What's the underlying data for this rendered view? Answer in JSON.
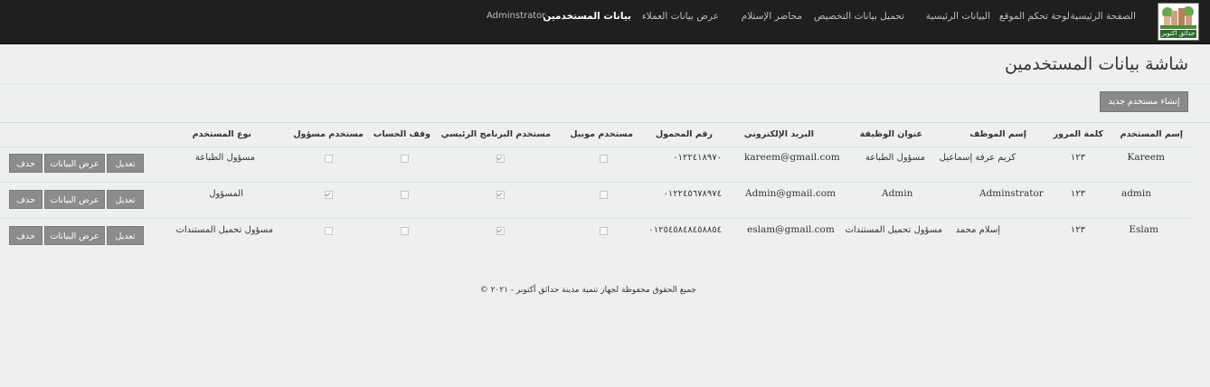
{
  "nav": {
    "logo_text": "حدائق أكتوبر",
    "items": [
      {
        "label": "الصفحة الرئيسية",
        "active": false
      },
      {
        "label": "لوحة تحكم الموقع",
        "active": false
      },
      {
        "label": "البيانات الرئيسية",
        "active": false
      },
      {
        "label": "تحميل بيانات التخصيص",
        "active": false
      },
      {
        "label": "محاضر الإستلام",
        "active": false
      },
      {
        "label": "عرض بيانات العملاء",
        "active": false
      },
      {
        "label": "بيانات المستخدمين",
        "active": true
      },
      {
        "label": "Adminstrator",
        "active": false
      }
    ]
  },
  "page": {
    "title": "شاشة بيانات المستخدمين",
    "create_button": "إنشاء مستخدم جديد"
  },
  "table": {
    "columns": [
      "إسم المستخدم",
      "كلمة المرور",
      "إسم الموظف",
      "عنوان الوظيفة",
      "البريد الإلكتروني",
      "رقم المحمول",
      "مستخدم موبيل",
      "مستخدم البرنامج الرئيسي",
      "وقف الحساب",
      "مستخدم مسؤول",
      "نوع المستخدم"
    ],
    "rows": [
      {
        "username": "Kareem",
        "password": "١٢٣",
        "employee": "كريم عرفة إسماعيل",
        "job": "مسؤول الطباعة",
        "email": "kareem@gmail.com",
        "mobile": "٠١٢٢٤١٨٩٧٠",
        "mobile_user": false,
        "main_user": true,
        "suspended": false,
        "admin_user": false,
        "type": "مسؤول الطباعة"
      },
      {
        "username": "admin",
        "password": "١٢٣",
        "employee": "Adminstrator",
        "job": "Admin",
        "email": "Admin@gmail.com",
        "mobile": "٠١٢٢٤٥٦٧٨٩٧٤",
        "mobile_user": false,
        "main_user": true,
        "suspended": false,
        "admin_user": true,
        "type": "المسؤول"
      },
      {
        "username": "Eslam",
        "password": "١٢٣",
        "employee": "إسلام محمد",
        "job": "مسؤول تحميل المستندات",
        "email": "eslam@gmail.com",
        "mobile": "٠١٢٥٤٥٨٤٨٤٥٨٨٥٤",
        "mobile_user": false,
        "main_user": true,
        "suspended": false,
        "admin_user": false,
        "type": "مسؤول تحميل المستندات"
      }
    ],
    "actions": {
      "edit": "تعديل",
      "view": "عرض البيانات",
      "delete": "حذف"
    }
  },
  "footer": {
    "text": "جميع الحقوق محفوظة لجهاز تنمية مدينة حدائق أكتوبر - ٢٠٢١ ©"
  }
}
